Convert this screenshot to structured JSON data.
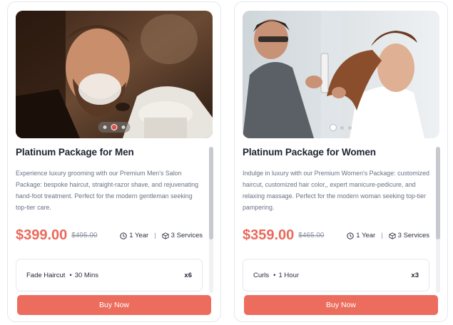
{
  "packages": [
    {
      "title": "Platinum Package for Men",
      "image_alt": "Man getting a straight-razor shave at a barber",
      "description": "Experience luxury grooming with our Premium Men's Salon Package: bespoke haircut, straight-razor shave, and rejuvenating hand-foot treatment. Perfect for the modern gentleman seeking top-tier care.",
      "price": "$399.00",
      "old_price": "$495.00",
      "duration": "1 Year",
      "services": "3 Services",
      "service_item": {
        "name": "Fade Haircut",
        "duration": "30 Mins",
        "qty": "x6"
      },
      "buy_label": "Buy Now",
      "carousel": {
        "count": 3,
        "active": 2
      }
    },
    {
      "title": "Platinum Package for Women",
      "image_alt": "Stylist styling a woman's hair",
      "description": "Indulge in luxury with our Premium Women's Package: customized haircut, customized hair color,, expert manicure-pedicure, and relaxing massage. Perfect for the modern woman seeking top-tier pampering.",
      "price": "$359.00",
      "old_price": "$465.00",
      "duration": "1 Year",
      "services": "3 Services",
      "service_item": {
        "name": "Curls",
        "duration": "1 Hour",
        "qty": "x3"
      },
      "buy_label": "Buy Now",
      "carousel": {
        "count": 3,
        "active": 1
      }
    }
  ],
  "colors": {
    "accent": "#ec6d5e",
    "price": "#e96a5b",
    "text": "#1f2430",
    "muted": "#6a7285"
  },
  "icons": {
    "duration": "clock-icon",
    "services": "box-icon"
  }
}
